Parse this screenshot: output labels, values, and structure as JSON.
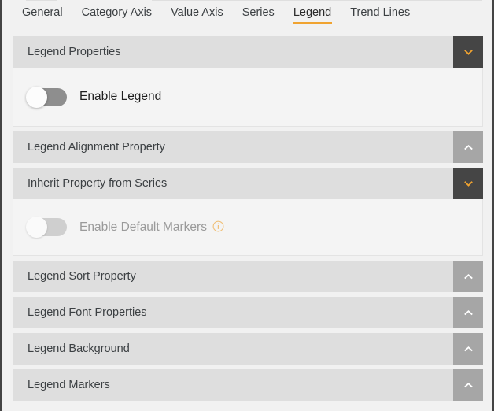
{
  "window": {
    "frame_border_color": "#444444",
    "background_color": "#f1f1f1"
  },
  "tabs": {
    "active": "Legend",
    "accent_color": "#f0a330",
    "items": [
      {
        "label": "General",
        "active": false
      },
      {
        "label": "Category Axis",
        "active": false
      },
      {
        "label": "Value Axis",
        "active": false
      },
      {
        "label": "Series",
        "active": false
      },
      {
        "label": "Legend",
        "active": true
      },
      {
        "label": "Trend Lines",
        "active": false
      }
    ]
  },
  "accordion": {
    "header_background": "#dedede",
    "body_background": "#f4f4f4",
    "collapsed_button_background": "#a6a6a6",
    "expanded_button_background": "#454545",
    "expanded_chevron_color": "#f0a330",
    "collapsed_chevron_color": "#ffffff",
    "sections": [
      {
        "title": "Legend Properties",
        "expanded": true,
        "toggle_icon": "chevron-down-icon",
        "controls": [
          {
            "type": "toggle",
            "label": "Enable Legend",
            "value": "off",
            "disabled": false,
            "info_icon": false
          }
        ]
      },
      {
        "title": "Legend Alignment Property",
        "expanded": false,
        "toggle_icon": "chevron-up-icon",
        "controls": []
      },
      {
        "title": "Inherit Property from Series",
        "expanded": true,
        "toggle_icon": "chevron-down-icon",
        "controls": [
          {
            "type": "toggle",
            "label": "Enable Default Markers",
            "value": "off",
            "disabled": true,
            "info_icon": true,
            "info_icon_name": "info-icon",
            "info_icon_color": "#f0c078"
          }
        ]
      },
      {
        "title": "Legend Sort Property",
        "expanded": false,
        "toggle_icon": "chevron-up-icon",
        "controls": []
      },
      {
        "title": "Legend Font Properties",
        "expanded": false,
        "toggle_icon": "chevron-up-icon",
        "controls": []
      },
      {
        "title": "Legend Background",
        "expanded": false,
        "toggle_icon": "chevron-up-icon",
        "controls": []
      },
      {
        "title": "Legend Markers",
        "expanded": false,
        "toggle_icon": "chevron-up-icon",
        "controls": []
      }
    ]
  }
}
